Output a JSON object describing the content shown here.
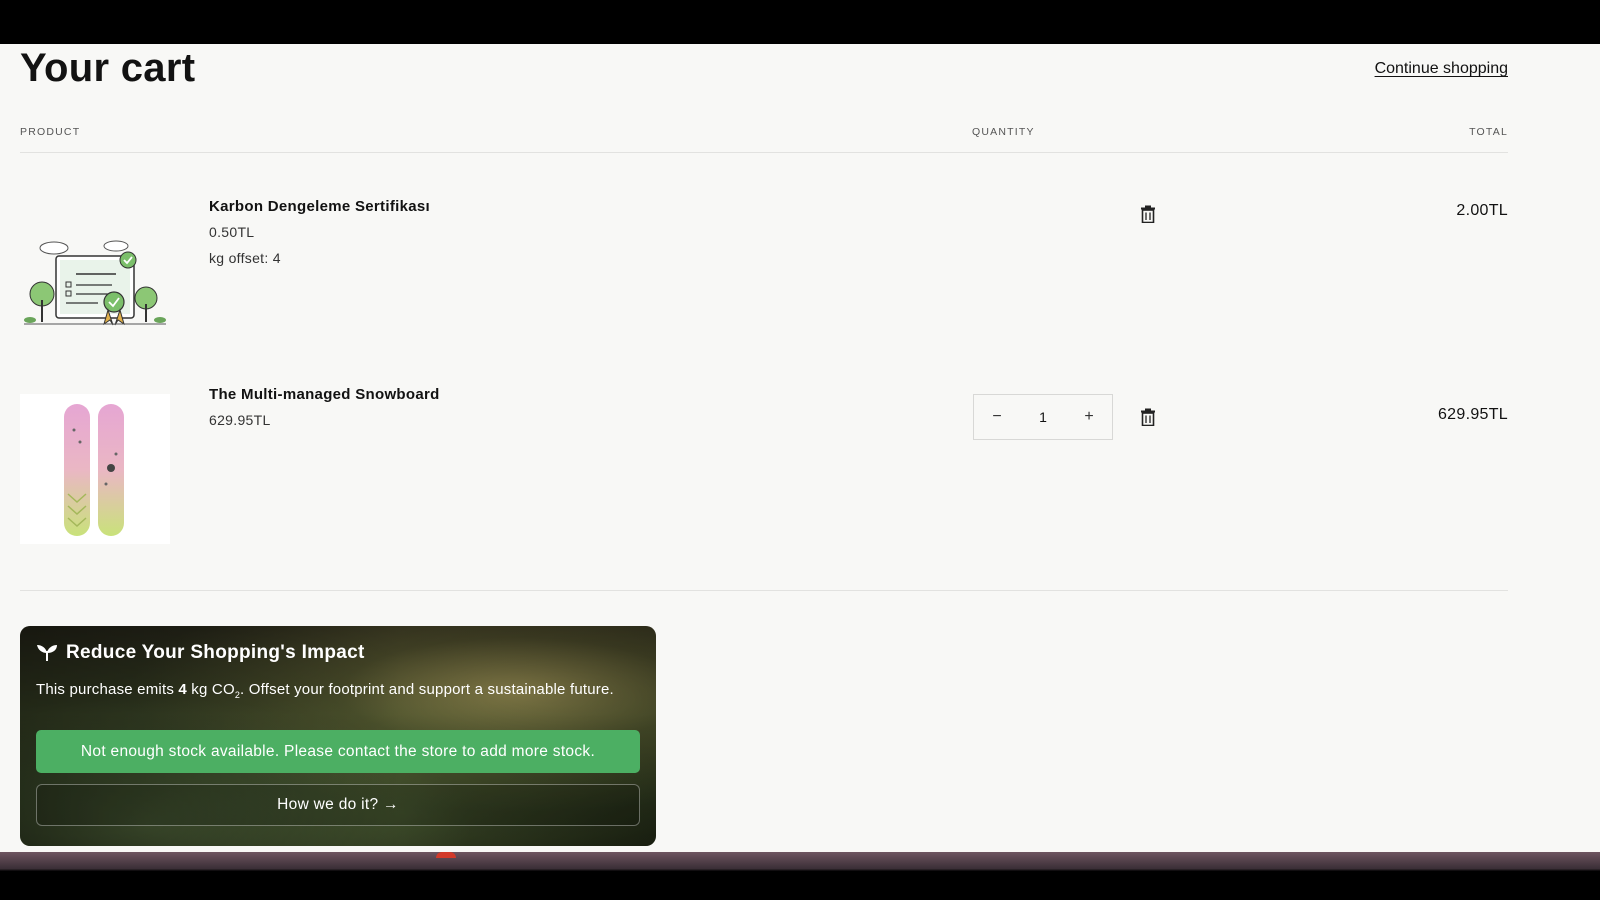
{
  "page": {
    "title": "Your cart",
    "continue_label": "Continue shopping"
  },
  "columns": {
    "product": "PRODUCT",
    "quantity": "QUANTITY",
    "total": "TOTAL"
  },
  "items": [
    {
      "name": "Karbon Dengeleme Sertifikası",
      "price": "0.50TL",
      "detail": "kg offset: 4",
      "total": "2.00TL",
      "image_icon": "certificate-illustration-icon"
    },
    {
      "name": "The Multi-managed Snowboard",
      "price": "629.95TL",
      "quantity": "1",
      "total": "629.95TL",
      "image_icon": "snowboard-image-icon"
    }
  ],
  "impact": {
    "title": "Reduce Your Shopping's Impact",
    "text_before": "This purchase emits ",
    "amount": "4",
    "unit": " kg CO",
    "subscript": "2",
    "text_after": ". Offset your footprint and support a sustainable future.",
    "stock_message": "Not enough stock available. Please contact the store to add more stock.",
    "how_label": "How we do it? →",
    "icon": "sprout-icon"
  },
  "colors": {
    "accent_green": "#4caf63",
    "text": "#121212",
    "background": "#f8f8f6"
  }
}
